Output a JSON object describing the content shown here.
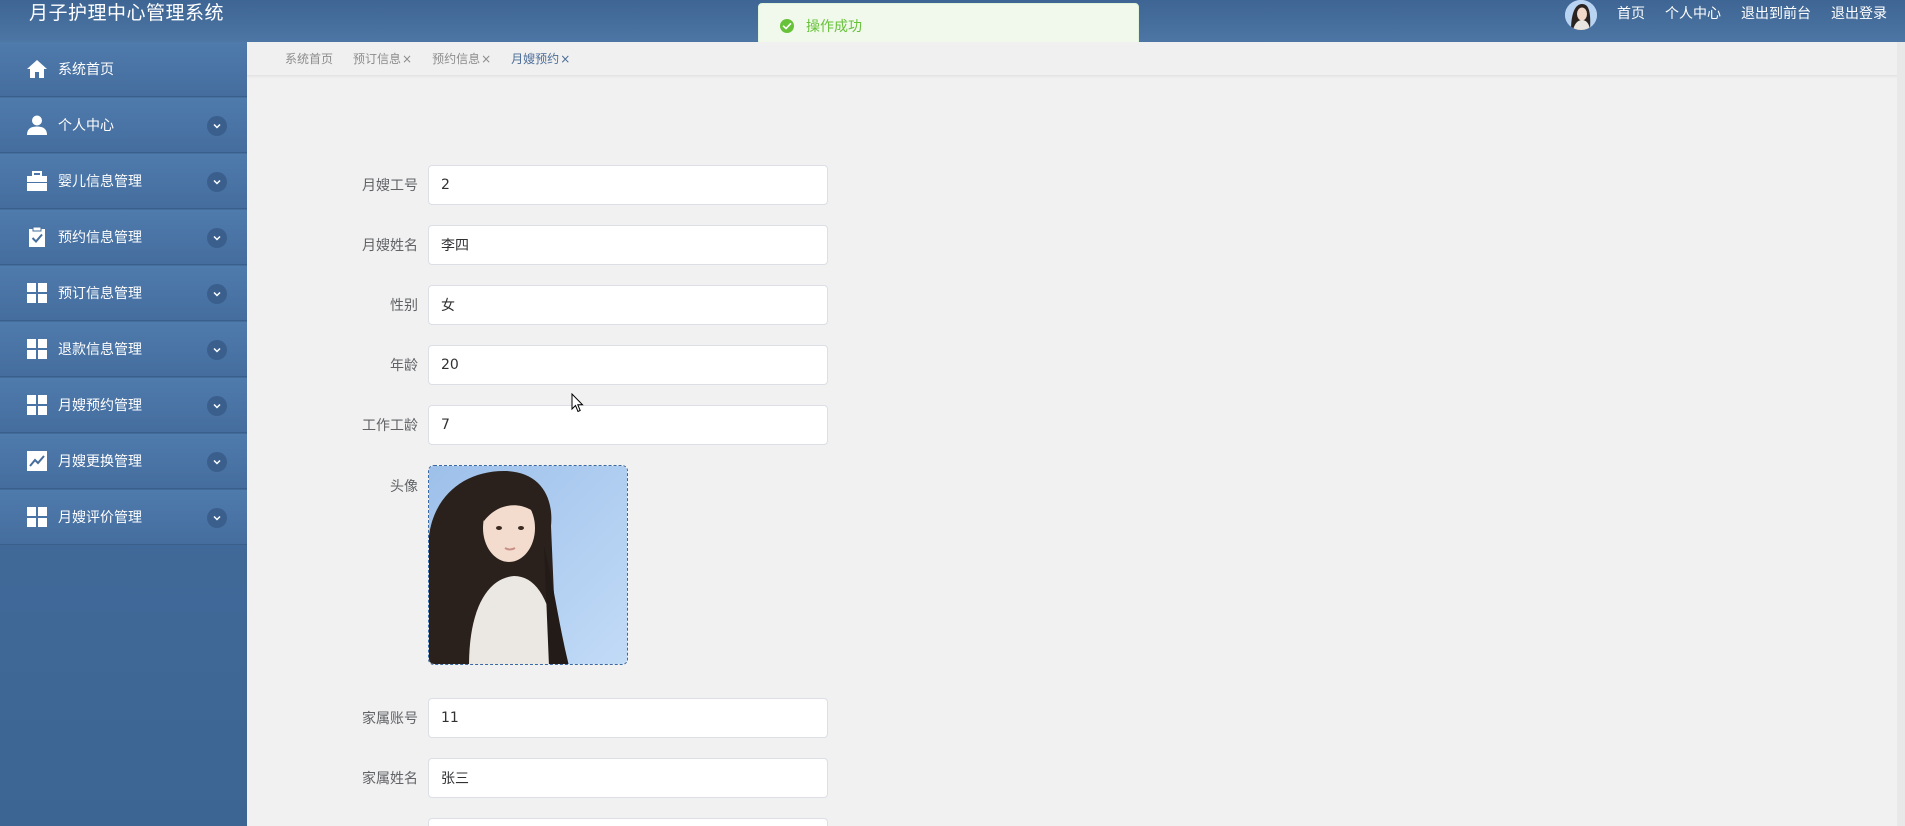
{
  "app": {
    "title": "月子护理中心管理系统"
  },
  "header": {
    "nav": [
      {
        "label": "首页"
      },
      {
        "label": "个人中心"
      },
      {
        "label": "退出到前台"
      },
      {
        "label": "退出登录"
      }
    ]
  },
  "toast": {
    "text": "操作成功",
    "color": "#67c23a"
  },
  "sidebar": {
    "items": [
      {
        "label": "系统首页",
        "icon": "home-icon",
        "expandable": false
      },
      {
        "label": "个人中心",
        "icon": "user-icon",
        "expandable": true
      },
      {
        "label": "婴儿信息管理",
        "icon": "briefcase-icon",
        "expandable": true
      },
      {
        "label": "预约信息管理",
        "icon": "clipboard-check-icon",
        "expandable": true
      },
      {
        "label": "预订信息管理",
        "icon": "grid-icon",
        "expandable": true
      },
      {
        "label": "退款信息管理",
        "icon": "grid-icon",
        "expandable": true
      },
      {
        "label": "月嫂预约管理",
        "icon": "grid-icon",
        "expandable": true
      },
      {
        "label": "月嫂更换管理",
        "icon": "chart-line-icon",
        "expandable": true
      },
      {
        "label": "月嫂评价管理",
        "icon": "grid-icon",
        "expandable": true
      }
    ]
  },
  "tabs": [
    {
      "label": "系统首页",
      "closable": false
    },
    {
      "label": "预订信息",
      "closable": true
    },
    {
      "label": "预约信息",
      "closable": true
    },
    {
      "label": "月嫂预约",
      "closable": true,
      "active": true
    }
  ],
  "tab_close_glyph": "×",
  "form": {
    "fields": [
      {
        "label": "月嫂工号",
        "value": "2"
      },
      {
        "label": "月嫂姓名",
        "value": "李四"
      },
      {
        "label": "性别",
        "value": "女"
      },
      {
        "label": "年龄",
        "value": "20"
      },
      {
        "label": "工作工龄",
        "value": "7"
      }
    ],
    "photo_label": "头像",
    "fields_after": [
      {
        "label": "家属账号",
        "value": "11"
      },
      {
        "label": "家属姓名",
        "value": "张三"
      },
      {
        "label": "",
        "value": ""
      }
    ]
  },
  "colors": {
    "header": "#4a72a1",
    "sidebar": "#456e9e",
    "accent": "#3a6aa5",
    "success": "#67c23a"
  }
}
